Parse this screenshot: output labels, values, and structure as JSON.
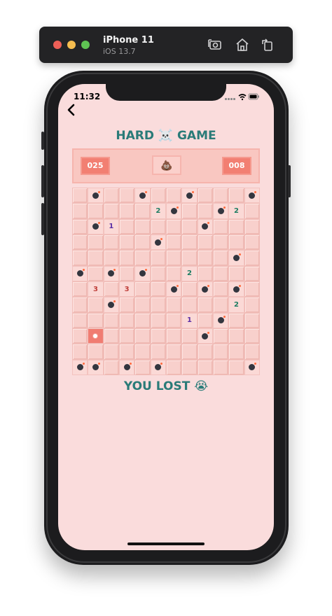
{
  "simulator": {
    "device_name": "iPhone 11",
    "os_version": "iOS 13.7"
  },
  "status_bar": {
    "time": "11:32"
  },
  "game": {
    "title": "HARD ☠️ GAME",
    "mine_counter": "025",
    "timer": "008",
    "face": "💩",
    "result": "YOU LOST 😭",
    "number_colors": {
      "1": "#5a2ea6",
      "2": "#1c7d62",
      "3": "#c0403b"
    },
    "board": [
      [
        "",
        "B",
        "",
        "",
        "B",
        "",
        "",
        "B",
        "",
        "",
        "",
        "B"
      ],
      [
        "",
        "",
        "",
        "",
        "",
        "2",
        "B",
        "",
        "",
        "B",
        "2",
        ""
      ],
      [
        "",
        "B",
        "1",
        "",
        "",
        "",
        "",
        "",
        "B",
        "",
        "",
        ""
      ],
      [
        "",
        "",
        "",
        "",
        "",
        "B",
        "",
        "",
        "",
        "",
        "",
        ""
      ],
      [
        "",
        "",
        "",
        "",
        "",
        "",
        "",
        "",
        "",
        "",
        "B",
        ""
      ],
      [
        "B",
        "",
        "B",
        "",
        "B",
        "",
        "",
        "2",
        "",
        "",
        "",
        ""
      ],
      [
        "",
        "3",
        "",
        "3",
        "",
        "",
        "B",
        "",
        "B",
        "",
        "B",
        ""
      ],
      [
        "",
        "",
        "B",
        "",
        "",
        "",
        "",
        "",
        "",
        "",
        "2",
        ""
      ],
      [
        "",
        "",
        "",
        "",
        "",
        "",
        "",
        "1",
        "",
        "B",
        "",
        ""
      ],
      [
        "",
        "X",
        "",
        "",
        "",
        "",
        "",
        "",
        "B",
        "",
        "",
        ""
      ],
      [
        "",
        "",
        "",
        "",
        "",
        "",
        "",
        "",
        "",
        "",
        "",
        ""
      ],
      [
        "B",
        "B",
        "",
        "B",
        "",
        "B",
        "",
        "",
        "",
        "",
        "",
        "B"
      ]
    ]
  }
}
